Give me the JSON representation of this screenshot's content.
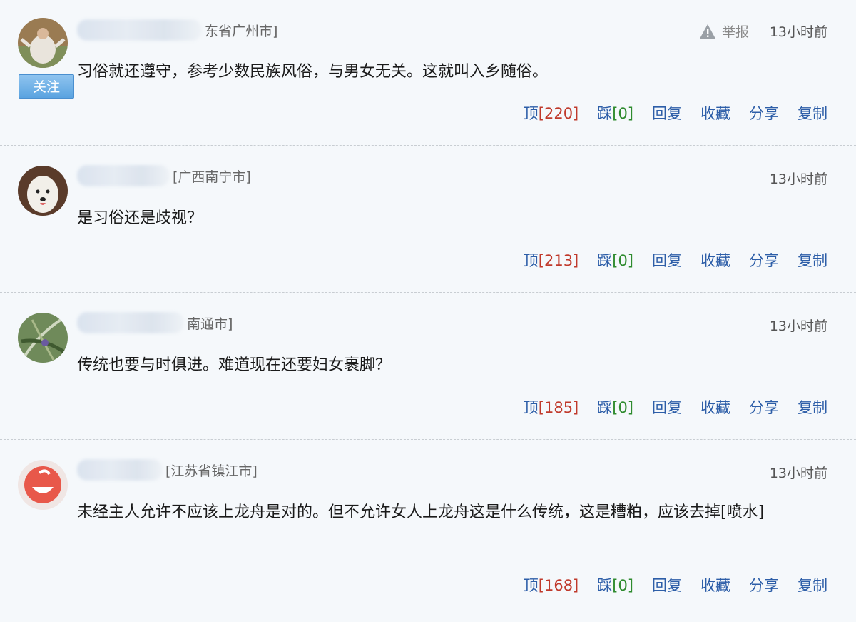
{
  "comments": [
    {
      "location_suffix": "东省广州市]",
      "report_label": "举报",
      "time": "13小时前",
      "follow_label": "关注",
      "text": "习俗就还遵守，参考少数民族风俗，与男女无关。这就叫入乡随俗。",
      "up_label": "顶",
      "up_count": "[220]",
      "down_label": "踩",
      "down_count": "[0]",
      "reply": "回复",
      "collect": "收藏",
      "share": "分享",
      "copy": "复制"
    },
    {
      "location_suffix": "[广西南宁市]",
      "time": "13小时前",
      "text": "是习俗还是歧视？",
      "up_label": "顶",
      "up_count": "[213]",
      "down_label": "踩",
      "down_count": "[0]",
      "reply": "回复",
      "collect": "收藏",
      "share": "分享",
      "copy": "复制"
    },
    {
      "location_suffix": "南通市]",
      "time": "13小时前",
      "text": "传统也要与时俱进。难道现在还要妇女裹脚？",
      "up_label": "顶",
      "up_count": "[185]",
      "down_label": "踩",
      "down_count": "[0]",
      "reply": "回复",
      "collect": "收藏",
      "share": "分享",
      "copy": "复制"
    },
    {
      "location_suffix": "[江苏省镇江市]",
      "time": "13小时前",
      "text": "未经主人允许不应该上龙舟是对的。但不允许女人上龙舟这是什么传统，这是糟粕，应该去掉[喷水]",
      "up_label": "顶",
      "up_count": "[168]",
      "down_label": "踩",
      "down_count": "[0]",
      "reply": "回复",
      "collect": "收藏",
      "share": "分享",
      "copy": "复制"
    }
  ]
}
